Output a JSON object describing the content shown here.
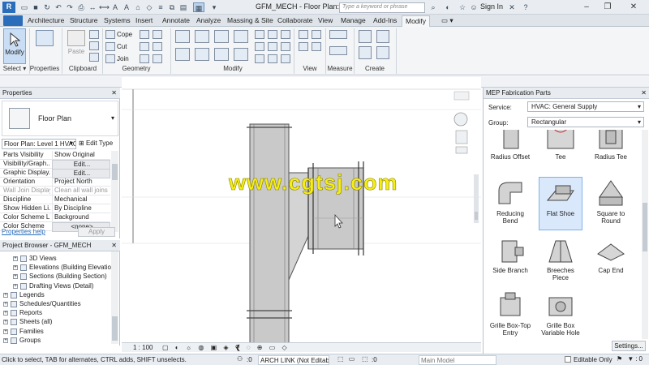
{
  "window": {
    "title": "GFM_MECH - Floor Plan: L...",
    "search_placeholder": "Type a keyword or phrase",
    "sign_in": "Sign In",
    "help": "?"
  },
  "tabs": [
    "Architecture",
    "Structure",
    "Systems",
    "Insert",
    "Annotate",
    "Analyze",
    "Massing & Site",
    "Collaborate",
    "View",
    "Manage",
    "Add-Ins",
    "Modify"
  ],
  "ribbon": {
    "modify_label": "Modify",
    "properties_label": "Properties",
    "paste_label": "Paste",
    "cope": "Cope",
    "cut": "Cut",
    "join": "Join",
    "panels": {
      "select": "Select",
      "properties": "Properties",
      "clipboard": "Clipboard",
      "geometry": "Geometry",
      "modify": "Modify",
      "view": "View",
      "measure": "Measure",
      "create": "Create"
    }
  },
  "properties": {
    "header": "Properties",
    "type_name": "Floor Plan",
    "instance_selector": "Floor Plan: Level 1 HVAC",
    "edit_type": "Edit Type",
    "rows": [
      {
        "k": "Parts Visibility",
        "v": "Show Original",
        "btn": false,
        "gray": false
      },
      {
        "k": "Visibility/Graph...",
        "v": "Edit...",
        "btn": true,
        "gray": false
      },
      {
        "k": "Graphic Display...",
        "v": "Edit...",
        "btn": true,
        "gray": false
      },
      {
        "k": "Orientation",
        "v": "Project North",
        "btn": false,
        "gray": false
      },
      {
        "k": "Wall Join Display",
        "v": "Clean all wall joins",
        "btn": false,
        "gray": true
      },
      {
        "k": "Discipline",
        "v": "Mechanical",
        "btn": false,
        "gray": false
      },
      {
        "k": "Show Hidden Li...",
        "v": "By Discipline",
        "btn": false,
        "gray": false
      },
      {
        "k": "Color Scheme L...",
        "v": "Background",
        "btn": false,
        "gray": false
      },
      {
        "k": "Color Scheme",
        "v": "<none>",
        "btn": true,
        "gray": false
      }
    ],
    "help": "Properties help",
    "apply": "Apply"
  },
  "browser": {
    "header": "Project Browser - GFM_MECH",
    "items": [
      {
        "label": "3D Views",
        "indent": 2
      },
      {
        "label": "Elevations (Building Elevation)",
        "indent": 2
      },
      {
        "label": "Sections (Building Section)",
        "indent": 2
      },
      {
        "label": "Drafting Views (Detail)",
        "indent": 2
      },
      {
        "label": "Legends",
        "indent": 0
      },
      {
        "label": "Schedules/Quantities",
        "indent": 0
      },
      {
        "label": "Reports",
        "indent": 0
      },
      {
        "label": "Sheets (all)",
        "indent": 0
      },
      {
        "label": "Families",
        "indent": 0
      },
      {
        "label": "Groups",
        "indent": 0
      }
    ]
  },
  "canvas": {
    "scale": "1 : 100",
    "watermark": "www.cgtsj.com"
  },
  "fabrication": {
    "header": "MEP Fabrication Parts",
    "service_label": "Service:",
    "service_value": "HVAC: General Supply",
    "group_label": "Group:",
    "group_value": "Rectangular",
    "parts": [
      [
        "Radius Offset",
        "Tee",
        "Radius Tee"
      ],
      [
        "Reducing Bend",
        "Flat Shoe",
        "Square to Round"
      ],
      [
        "Side Branch",
        "Breeches Piece",
        "Cap End"
      ],
      [
        "Grille Box-Top Entry",
        "Grille Box Variable Hole",
        ""
      ]
    ],
    "selected": "Flat Shoe",
    "settings": "Settings..."
  },
  "status": {
    "message": "Click to select, TAB for alternates, CTRL adds, SHIFT unselects.",
    "zero1": ":0",
    "workset": "ARCH LINK (Not Editable)",
    "zero2": ":0",
    "design_option": "Main Model",
    "editable_only": "Editable Only"
  },
  "colors": {
    "accent": "#2a6ebb",
    "selected_tile": "#d9e9fb",
    "watermark": "#f5ef16"
  }
}
